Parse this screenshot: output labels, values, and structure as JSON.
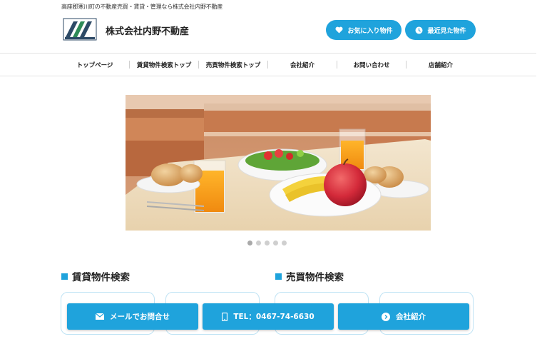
{
  "header": {
    "tagline": "高座郡寒川町の不動産売買・賃貸・管理なら株式会社内野不動産",
    "company_name": "株式会社内野不動産",
    "favorites_label": "お気に入り物件",
    "recent_label": "最近見た物件"
  },
  "nav": {
    "items": [
      {
        "label": "トップページ"
      },
      {
        "label": "賃貸物件検索トップ"
      },
      {
        "label": "売買物件検索トップ"
      },
      {
        "label": "会社紹介"
      },
      {
        "label": "お問い合わせ"
      },
      {
        "label": "店舗紹介"
      }
    ]
  },
  "slider": {
    "slide_count": 5,
    "active_index": 0
  },
  "sections": {
    "rent_title": "賃貸物件検索",
    "sale_title": "売買物件検索"
  },
  "footer_bar": {
    "mail_label": "メールでお問合せ",
    "tel_label": "TEL：0467-74-6630",
    "about_label": "会社紹介"
  },
  "colors": {
    "accent": "#1fa3dc",
    "text": "#222222"
  },
  "icons": {
    "favorites": "heart-icon",
    "recent": "clock-icon",
    "mail": "envelope-icon",
    "tel": "phone-icon",
    "about": "arrow-right-circle-icon"
  }
}
